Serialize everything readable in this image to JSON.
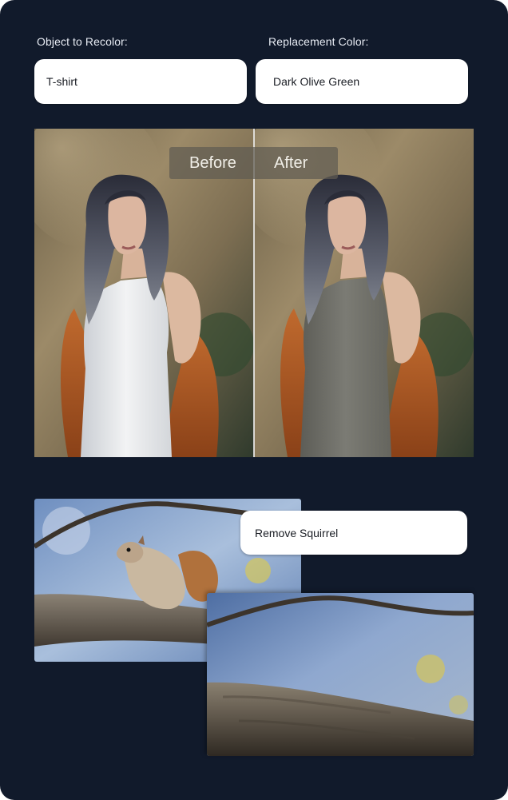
{
  "recolor": {
    "object_label": "Object to Recolor:",
    "object_value": "T-shirt",
    "color_label": "Replacement Color:",
    "color_value": "Dark Olive Green"
  },
  "comparison": {
    "before_label": "Before",
    "after_label": "After"
  },
  "removal": {
    "prompt_value": "Remove Squirrel"
  },
  "colors": {
    "panel_bg": "#111a2b",
    "input_bg": "#ffffff",
    "shirt_before": "#eceef0",
    "shirt_after": "#76766f",
    "jacket": "#b8612a"
  }
}
